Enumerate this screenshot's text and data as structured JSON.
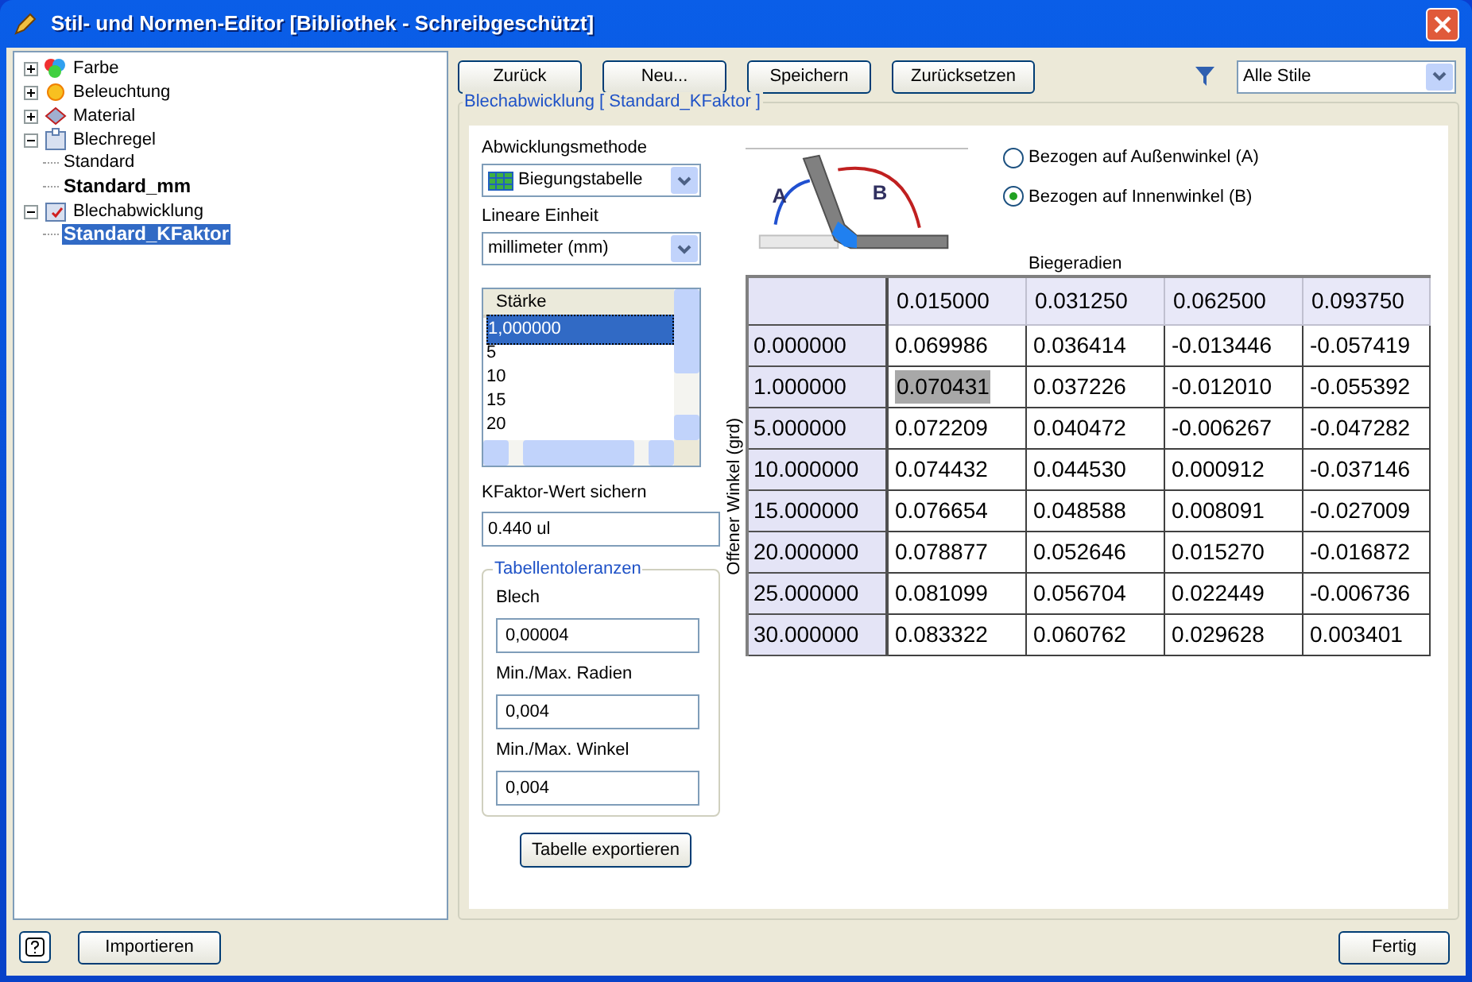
{
  "window": {
    "title": "Stil- und Normen-Editor [Bibliothek - Schreibgeschützt]"
  },
  "tree": [
    {
      "label": "Farbe",
      "kind": "color",
      "expanded": false
    },
    {
      "label": "Beleuchtung",
      "kind": "light",
      "expanded": false
    },
    {
      "label": "Material",
      "kind": "material",
      "expanded": false
    },
    {
      "label": "Blechregel",
      "kind": "sheet",
      "expanded": true,
      "children": [
        {
          "label": "Standard",
          "in_use": false,
          "selected": false
        },
        {
          "label": "Standard_mm",
          "in_use": true,
          "selected": false
        }
      ]
    },
    {
      "label": "Blechabwicklung",
      "kind": "unfold",
      "expanded": true,
      "children": [
        {
          "label": "Standard_KFaktor",
          "in_use": true,
          "selected": true
        }
      ]
    }
  ],
  "toolbar": {
    "buttons": [
      "Zurück",
      "Neu...",
      "Speichern",
      "Zurücksetzen"
    ],
    "filter": "Alle Stile"
  },
  "panel": {
    "title": "Blechabwicklung [ Standard_KFaktor ]",
    "method_label": "Abwicklungsmethode",
    "method": "Biegungstabelle",
    "unit_label": "Lineare Einheit",
    "unit": "millimeter (mm)",
    "diagram_labels": [
      "A",
      "B"
    ],
    "radios": [
      {
        "label": "Bezogen auf Außenwinkel (A)",
        "selected": false
      },
      {
        "label": "Bezogen auf Innenwinkel (B)",
        "selected": true
      }
    ],
    "thickness": {
      "header": "Stärke",
      "items": [
        {
          "label": "1,000000",
          "selected": true
        },
        {
          "label": "5",
          "selected": false
        },
        {
          "label": "10",
          "selected": false
        },
        {
          "label": "15",
          "selected": false
        },
        {
          "label": "20",
          "selected": false
        }
      ]
    },
    "kfactor_label": "KFaktor-Wert sichern",
    "kfactor": "0.440 ul",
    "tolerances": {
      "title": "Tabellentoleranzen",
      "fields": [
        {
          "label": "Blech",
          "value": "0,00004"
        },
        {
          "label": "Min./Max. Radien",
          "value": "0,004"
        },
        {
          "label": "Min./Max. Winkel",
          "value": "0,004"
        }
      ]
    },
    "export_button": "Tabelle exportieren"
  },
  "table": {
    "column_title": "Biegeradien",
    "row_title": "Offener Winkel (grd)",
    "columns": [
      "0.015000",
      "0.031250",
      "0.062500",
      "0.093750"
    ],
    "rows": [
      {
        "label": "0.000000",
        "cells": [
          {
            "value": "0.069986",
            "selected": false
          },
          {
            "value": "0.036414",
            "selected": false
          },
          {
            "value": "-0.013446",
            "selected": false
          },
          {
            "value": "-0.057419",
            "selected": false
          }
        ]
      },
      {
        "label": "1.000000",
        "cells": [
          {
            "value": "0.070431",
            "selected": true
          },
          {
            "value": "0.037226",
            "selected": false
          },
          {
            "value": "-0.012010",
            "selected": false
          },
          {
            "value": "-0.055392",
            "selected": false
          }
        ]
      },
      {
        "label": "5.000000",
        "cells": [
          {
            "value": "0.072209",
            "selected": false
          },
          {
            "value": "0.040472",
            "selected": false
          },
          {
            "value": "-0.006267",
            "selected": false
          },
          {
            "value": "-0.047282",
            "selected": false
          }
        ]
      },
      {
        "label": "10.000000",
        "cells": [
          {
            "value": "0.074432",
            "selected": false
          },
          {
            "value": "0.044530",
            "selected": false
          },
          {
            "value": "0.000912",
            "selected": false
          },
          {
            "value": "-0.037146",
            "selected": false
          }
        ]
      },
      {
        "label": "15.000000",
        "cells": [
          {
            "value": "0.076654",
            "selected": false
          },
          {
            "value": "0.048588",
            "selected": false
          },
          {
            "value": "0.008091",
            "selected": false
          },
          {
            "value": "-0.027009",
            "selected": false
          }
        ]
      },
      {
        "label": "20.000000",
        "cells": [
          {
            "value": "0.078877",
            "selected": false
          },
          {
            "value": "0.052646",
            "selected": false
          },
          {
            "value": "0.015270",
            "selected": false
          },
          {
            "value": "-0.016872",
            "selected": false
          }
        ]
      },
      {
        "label": "25.000000",
        "cells": [
          {
            "value": "0.081099",
            "selected": false
          },
          {
            "value": "0.056704",
            "selected": false
          },
          {
            "value": "0.022449",
            "selected": false
          },
          {
            "value": "-0.006736",
            "selected": false
          }
        ]
      },
      {
        "label": "30.000000",
        "cells": [
          {
            "value": "0.083322",
            "selected": false
          },
          {
            "value": "0.060762",
            "selected": false
          },
          {
            "value": "0.029628",
            "selected": false
          },
          {
            "value": "0.003401",
            "selected": false
          }
        ]
      }
    ]
  },
  "footer": {
    "import_button": "Importieren",
    "done_button": "Fertig"
  }
}
